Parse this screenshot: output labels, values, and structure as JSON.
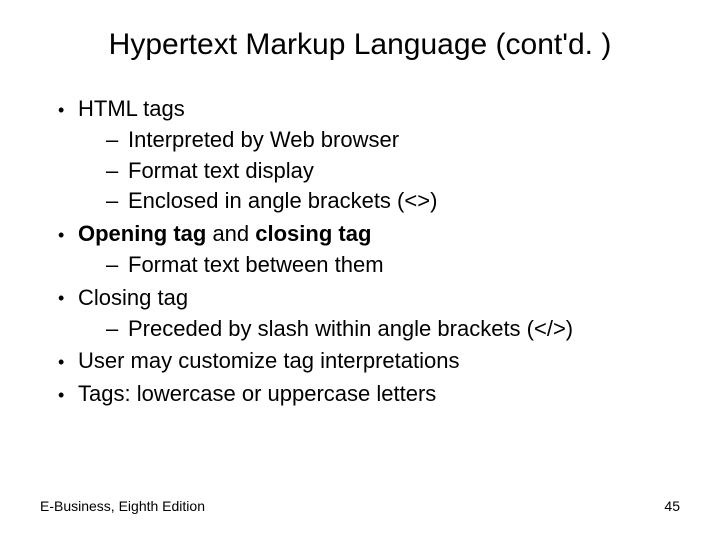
{
  "title": "Hypertext Markup Language (cont'd. )",
  "bullets": {
    "b1": "HTML tags",
    "b1_1": "Interpreted by Web browser",
    "b1_2": "Format text display",
    "b1_3": "Enclosed in angle brackets (<>)",
    "b2_pre": "Opening tag",
    "b2_mid": " and ",
    "b2_post": "closing tag",
    "b2_1": "Format text between them",
    "b3": "Closing tag",
    "b3_1": "Preceded by slash within angle brackets (</>)",
    "b4": "User may customize tag interpretations",
    "b5": "Tags: lowercase or uppercase letters"
  },
  "footer": {
    "left": "E-Business, Eighth Edition",
    "right": "45"
  }
}
